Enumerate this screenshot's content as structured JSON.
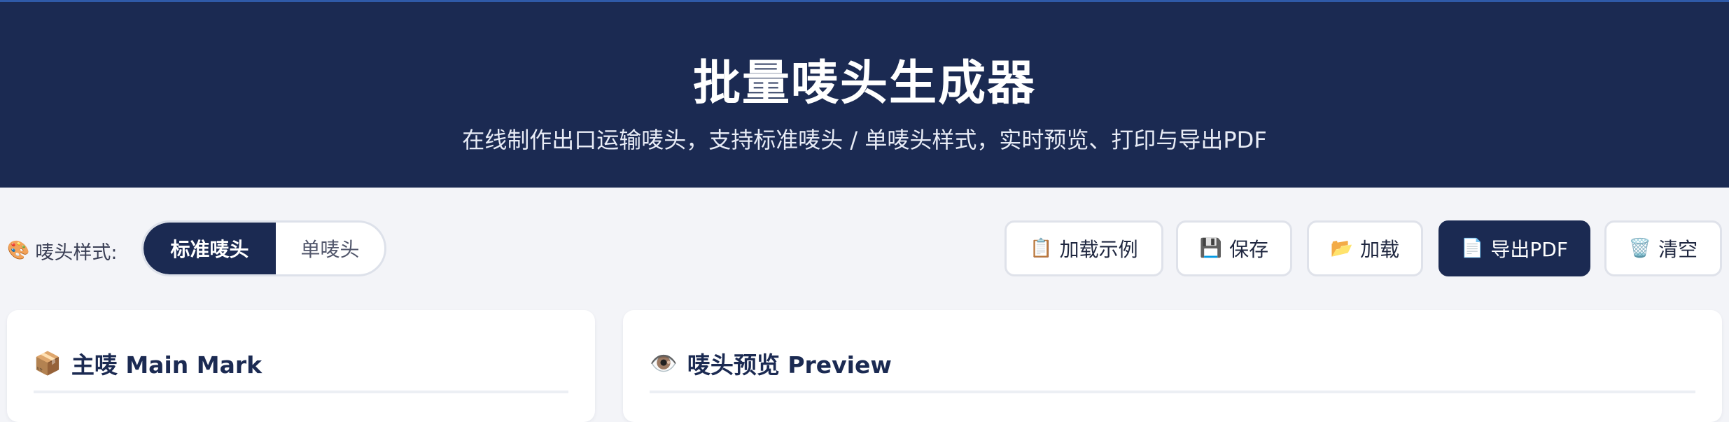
{
  "header": {
    "title": "批量唛头生成器",
    "subtitle": "在线制作出口运输唛头，支持标准唛头 / 单唛头样式，实时预览、打印与导出PDF"
  },
  "style_selector": {
    "icon": "🎨",
    "label": "唛头样式:",
    "options": [
      "标准唛头",
      "单唛头"
    ],
    "selected": "标准唛头"
  },
  "actions": {
    "load_example": {
      "icon": "📋",
      "label": "加载示例"
    },
    "save": {
      "icon": "💾",
      "label": "保存"
    },
    "load": {
      "icon": "📂",
      "label": "加载"
    },
    "export_pdf": {
      "icon": "📄",
      "label": "导出PDF"
    },
    "clear": {
      "icon": "🗑️",
      "label": "清空"
    }
  },
  "panels": {
    "main_mark": {
      "icon": "📦",
      "title": "主唛 Main Mark"
    },
    "preview": {
      "icon": "👁️",
      "title": "唛头预览 Preview"
    }
  },
  "colors": {
    "header_bg": "#1b2a52",
    "page_bg": "#f3f4f8",
    "accent": "#1b2a52"
  }
}
